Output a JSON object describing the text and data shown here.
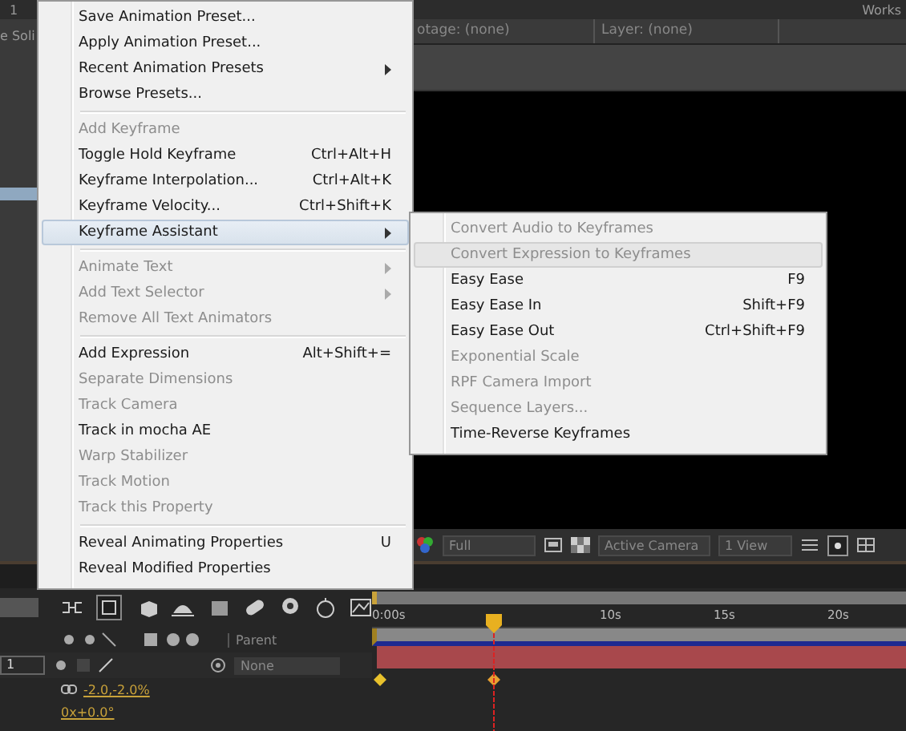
{
  "top_bar": {
    "workspace": "Works",
    "index": "1"
  },
  "left_panel": {
    "label": "e Soli"
  },
  "viewer_tabs": [
    {
      "label": "otage: (none)"
    },
    {
      "label": "Layer: (none)"
    }
  ],
  "viewer_toolbar": {
    "resolution": "Full",
    "camera": "Active Camera",
    "views": "1 View"
  },
  "menu": {
    "items": [
      {
        "kind": "item",
        "label": "Save Animation Preset...",
        "disabled": false,
        "submenu": false,
        "selected": false
      },
      {
        "kind": "item",
        "label": "Apply Animation Preset...",
        "disabled": false,
        "submenu": false,
        "selected": false
      },
      {
        "kind": "item",
        "label": "Recent Animation Presets",
        "disabled": false,
        "submenu": true,
        "selected": false
      },
      {
        "kind": "item",
        "label": "Browse Presets...",
        "disabled": false,
        "submenu": false,
        "selected": false
      },
      {
        "kind": "separator"
      },
      {
        "kind": "item",
        "label": "Add Keyframe",
        "disabled": true,
        "submenu": false,
        "selected": false
      },
      {
        "kind": "item",
        "label": "Toggle Hold Keyframe",
        "shortcut": "Ctrl+Alt+H",
        "disabled": false,
        "submenu": false,
        "selected": false
      },
      {
        "kind": "item",
        "label": "Keyframe Interpolation...",
        "shortcut": "Ctrl+Alt+K",
        "disabled": false,
        "submenu": false,
        "selected": false
      },
      {
        "kind": "item",
        "label": "Keyframe Velocity...",
        "shortcut": "Ctrl+Shift+K",
        "disabled": false,
        "submenu": false,
        "selected": false
      },
      {
        "kind": "item",
        "label": "Keyframe Assistant",
        "disabled": false,
        "submenu": true,
        "selected": true
      },
      {
        "kind": "separator"
      },
      {
        "kind": "item",
        "label": "Animate Text",
        "disabled": true,
        "submenu": true,
        "selected": false
      },
      {
        "kind": "item",
        "label": "Add Text Selector",
        "disabled": true,
        "submenu": true,
        "selected": false
      },
      {
        "kind": "item",
        "label": "Remove All Text Animators",
        "disabled": true,
        "submenu": false,
        "selected": false
      },
      {
        "kind": "separator"
      },
      {
        "kind": "item",
        "label": "Add Expression",
        "shortcut": "Alt+Shift+=",
        "disabled": false,
        "submenu": false,
        "selected": false
      },
      {
        "kind": "item",
        "label": "Separate Dimensions",
        "disabled": true,
        "submenu": false,
        "selected": false
      },
      {
        "kind": "item",
        "label": "Track Camera",
        "disabled": true,
        "submenu": false,
        "selected": false
      },
      {
        "kind": "item",
        "label": "Track in mocha AE",
        "disabled": false,
        "submenu": false,
        "selected": false
      },
      {
        "kind": "item",
        "label": "Warp Stabilizer",
        "disabled": true,
        "submenu": false,
        "selected": false
      },
      {
        "kind": "item",
        "label": "Track Motion",
        "disabled": true,
        "submenu": false,
        "selected": false
      },
      {
        "kind": "item",
        "label": "Track this Property",
        "disabled": true,
        "submenu": false,
        "selected": false
      },
      {
        "kind": "separator"
      },
      {
        "kind": "item",
        "label": "Reveal Animating Properties",
        "shortcut": "U",
        "disabled": false,
        "submenu": false,
        "selected": false
      },
      {
        "kind": "item",
        "label": "Reveal Modified Properties",
        "disabled": false,
        "submenu": false,
        "selected": false
      }
    ]
  },
  "submenu": {
    "items": [
      {
        "kind": "item",
        "label": "Convert Audio to Keyframes",
        "disabled": true,
        "selected": false
      },
      {
        "kind": "item",
        "label": "Convert Expression to Keyframes",
        "disabled": true,
        "selected": true
      },
      {
        "kind": "item",
        "label": "Easy Ease",
        "shortcut": "F9",
        "disabled": false,
        "selected": false
      },
      {
        "kind": "item",
        "label": "Easy Ease In",
        "shortcut": "Shift+F9",
        "disabled": false,
        "selected": false
      },
      {
        "kind": "item",
        "label": "Easy Ease Out",
        "shortcut": "Ctrl+Shift+F9",
        "disabled": false,
        "selected": false
      },
      {
        "kind": "item",
        "label": "Exponential Scale",
        "disabled": true,
        "selected": false
      },
      {
        "kind": "item",
        "label": "RPF Camera Import",
        "disabled": true,
        "selected": false
      },
      {
        "kind": "item",
        "label": "Sequence Layers...",
        "disabled": true,
        "selected": false
      },
      {
        "kind": "item",
        "label": "Time-Reverse Keyframes",
        "disabled": false,
        "selected": false
      }
    ]
  },
  "timeline": {
    "ruler": [
      "0:00s",
      "10s",
      "15s",
      "20s"
    ],
    "parent_header": "Parent",
    "layer_number": "1",
    "parent": "None",
    "scale": "-2.0,-2.0%",
    "rotation": "0x+0.0°"
  }
}
